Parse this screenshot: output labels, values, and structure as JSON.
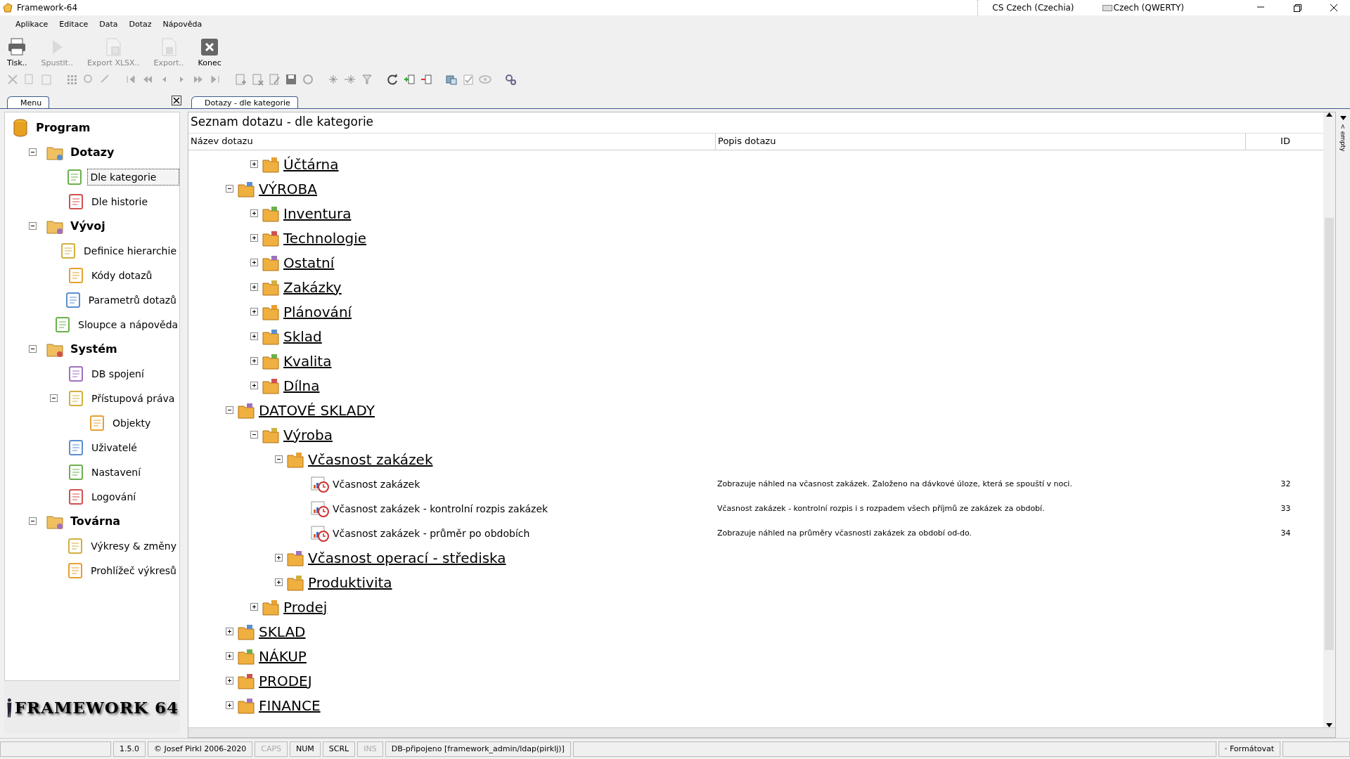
{
  "window": {
    "title": "Framework-64",
    "language": "CS Czech (Czechia)",
    "keyboard": "Czech (QWERTY)"
  },
  "menu_bar": [
    "Aplikace",
    "Editace",
    "Data",
    "Dotaz",
    "Nápověda"
  ],
  "toolbar": [
    {
      "label": "Tisk..",
      "kind": "print",
      "disabled": false
    },
    {
      "label": "Spustit..",
      "kind": "run",
      "disabled": true
    },
    {
      "label": "Export XLSX..",
      "kind": "xlsx",
      "disabled": true
    },
    {
      "label": "Export..",
      "kind": "export",
      "disabled": true
    },
    {
      "label": "Konec",
      "kind": "close",
      "disabled": false
    }
  ],
  "side_panel": {
    "tab": "Menu",
    "items": [
      {
        "label": "Program",
        "kind": "root",
        "selected": false,
        "children": [
          {
            "label": "Dotazy",
            "kind": "group",
            "selected": false,
            "expanded": true,
            "children": [
              {
                "label": "Dle kategorie",
                "kind": "item",
                "selected": true
              },
              {
                "label": "Dle historie",
                "kind": "item",
                "selected": false
              }
            ]
          },
          {
            "label": "Vývoj",
            "kind": "group",
            "selected": false,
            "expanded": true,
            "children": [
              {
                "label": "Definice hierarchie",
                "kind": "item",
                "selected": false
              },
              {
                "label": "Kódy dotazů",
                "kind": "item",
                "selected": false
              },
              {
                "label": "Parametrů dotazů",
                "kind": "item",
                "selected": false
              },
              {
                "label": "Sloupce a nápověda",
                "kind": "item",
                "selected": false
              }
            ]
          },
          {
            "label": "Systém",
            "kind": "group",
            "selected": false,
            "expanded": true,
            "children": [
              {
                "label": "DB spojení",
                "kind": "item",
                "selected": false
              },
              {
                "label": "Přístupová práva",
                "kind": "item",
                "selected": false,
                "expanded": true,
                "children": [
                  {
                    "label": "Objekty",
                    "kind": "item",
                    "selected": false
                  }
                ]
              },
              {
                "label": "Uživatelé",
                "kind": "item",
                "selected": false
              },
              {
                "label": "Nastavení",
                "kind": "item",
                "selected": false
              },
              {
                "label": "Logování",
                "kind": "item",
                "selected": false
              }
            ]
          },
          {
            "label": "Továrna",
            "kind": "group",
            "selected": false,
            "expanded": true,
            "children": [
              {
                "label": "Výkresy & změny",
                "kind": "item",
                "selected": false
              },
              {
                "label": "Prohlížeč výkresů",
                "kind": "item",
                "selected": false
              }
            ]
          }
        ]
      }
    ],
    "logo": "FRAMEWORK 64"
  },
  "document_tab": {
    "label": "Dotazy - dle kategorie",
    "selected": true
  },
  "side_strip": "< empty",
  "grid": {
    "title": "Seznam dotazu - dle kategorie",
    "columns": [
      "Název dotazu",
      "Popis dotazu",
      "ID"
    ],
    "rows": [
      {
        "kind": "hidden",
        "children": [
          {
            "label": "Účtárna",
            "kind": "category",
            "expanded": false
          }
        ]
      },
      {
        "label": "VÝROBA",
        "kind": "category",
        "expanded": true,
        "children": [
          {
            "label": "Inventura",
            "kind": "category",
            "expanded": false
          },
          {
            "label": "Technologie",
            "kind": "category",
            "expanded": false
          },
          {
            "label": "Ostatní",
            "kind": "category",
            "expanded": false
          },
          {
            "label": "Zakázky",
            "kind": "category",
            "expanded": false
          },
          {
            "label": "Plánování",
            "kind": "category",
            "expanded": false
          },
          {
            "label": "Sklad",
            "kind": "category",
            "expanded": false
          },
          {
            "label": "Kvalita",
            "kind": "category",
            "expanded": false
          },
          {
            "label": "Dílna",
            "kind": "category",
            "expanded": false
          }
        ]
      },
      {
        "label": "DATOVÉ SKLADY",
        "kind": "category",
        "expanded": true,
        "children": [
          {
            "label": "Výroba",
            "kind": "category",
            "expanded": true,
            "children": [
              {
                "label": "Včasnost zakázek",
                "kind": "category",
                "expanded": true,
                "children": [
                  {
                    "label": "Včasnost zakázek",
                    "kind": "query",
                    "description": "Zobrazuje náhled na včasnost zakázek. Založeno na dávkové úloze, která se spouští v noci.",
                    "id": "32"
                  },
                  {
                    "label": "Včasnost zakázek - kontrolní rozpis zakázek",
                    "kind": "query",
                    "description": "Včasnost zakázek - kontrolní rozpis i s rozpadem všech příjmů ze zakázek za období.",
                    "id": "33"
                  },
                  {
                    "label": "Včasnost zakázek - průměr po obdobích",
                    "kind": "query",
                    "description": "Zobrazuje náhled na průměry včasnosti zakázek za období od-do.",
                    "id": "34"
                  }
                ]
              },
              {
                "label": "Včasnost operací - střediska",
                "kind": "category",
                "expanded": false
              },
              {
                "label": "Produktivita",
                "kind": "category",
                "expanded": false
              }
            ]
          },
          {
            "label": "Prodej",
            "kind": "category",
            "expanded": false
          }
        ]
      },
      {
        "label": "SKLAD",
        "kind": "category",
        "expanded": false
      },
      {
        "label": "NÁKUP",
        "kind": "category",
        "expanded": false
      },
      {
        "label": "PRODEJ",
        "kind": "category",
        "expanded": false
      },
      {
        "label": "FINANCE",
        "kind": "category",
        "expanded": false
      }
    ]
  },
  "status_bar": {
    "panels": [
      {
        "text": "1.5.0",
        "disabled": false
      },
      {
        "text": "© Josef Pirkl 2006-2020",
        "disabled": false
      },
      {
        "text": "CAPS",
        "disabled": true
      },
      {
        "text": "NUM",
        "disabled": false
      },
      {
        "text": "SCRL",
        "disabled": false
      },
      {
        "text": "INS",
        "disabled": true
      },
      {
        "text": "DB-připojeno [framework_admin/ldap(pirklj)]",
        "disabled": false
      }
    ],
    "format": {
      "label": "Formátovat",
      "checked": true
    }
  }
}
